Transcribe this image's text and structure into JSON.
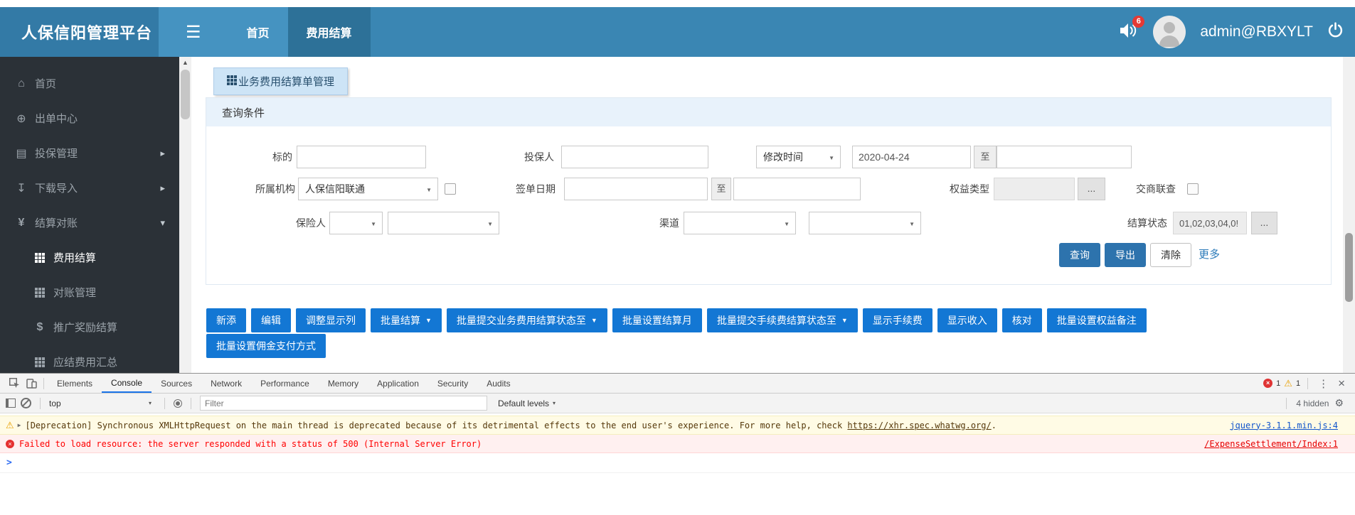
{
  "colors": {
    "navbar": "#3a86b3",
    "navbar_active_tab": "#2d7198",
    "sidebar_bg": "#2b3137",
    "action_button_blue": "#1377d4",
    "primary_button_blue": "#2d73ad",
    "badge_red": "#e53935",
    "devtools_active_tab_underline": "#1a73e8",
    "console_warning_bg": "#fffbe5",
    "console_error_bg": "#fff0f0"
  },
  "icons": {
    "burger": "☰",
    "caret_down": "▼",
    "caret_small": "▾",
    "chevron_right": "▸",
    "chevron_down": "▾",
    "scroll_up": "▲",
    "home": "⌂",
    "globe": "⊕",
    "document": "▤",
    "download": "↧",
    "yen": "¥",
    "dollar": "$",
    "warning": "⚠",
    "gear": "⚙",
    "dots": "⋮",
    "close": "×",
    "cross": "×",
    "expand": "▶"
  },
  "navbar": {
    "title": "人保信阳管理平台",
    "home_tab": "首页",
    "active_tab": "费用结算",
    "notification_count": "6",
    "username": "admin@RBXYLT"
  },
  "sidebar": {
    "items": [
      {
        "label": "首页",
        "icon": "home"
      },
      {
        "label": "出单中心",
        "icon": "globe"
      },
      {
        "label": "投保管理",
        "icon": "document",
        "chevron": "right"
      },
      {
        "label": "下载导入",
        "icon": "download",
        "chevron": "right"
      },
      {
        "label": "结算对账",
        "icon": "yen",
        "chevron": "down"
      },
      {
        "label": "费用结算",
        "icon": "grid",
        "active": true
      },
      {
        "label": "对账管理",
        "icon": "grid"
      },
      {
        "label": "推广奖励结算",
        "icon": "dollar"
      },
      {
        "label": "应结费用汇总",
        "icon": "grid"
      }
    ]
  },
  "main": {
    "page_tab": "业务费用结算单管理",
    "panel_title": "查询条件",
    "form": {
      "subject_label": "标的",
      "applicant_label": "投保人",
      "time_type": "修改时间",
      "date_from": "2020-04-24",
      "to": "至",
      "org_label": "所属机构",
      "org_value": "人保信阳联通",
      "sign_date_label": "签单日期",
      "equity_label": "权益类型",
      "ellipsis": "...",
      "cross_check_label": "交商联查",
      "insurer_label": "保险人",
      "channel_label": "渠道",
      "settle_status_label": "结算状态",
      "settle_status_value": "01,02,03,04,0!"
    },
    "query_btn": "查询",
    "export_btn": "导出",
    "clear_btn": "清除",
    "more_link": "更多",
    "actions_row1": [
      "新添",
      "编辑",
      "调整显示列",
      "批量结算",
      "批量提交业务费用结算状态至",
      "批量设置结算月",
      "批量提交手续费结算状态至",
      "显示手续费",
      "显示收入",
      "核对",
      "批量设置权益备注"
    ],
    "actions_row2": [
      "批量设置佣金支付方式"
    ]
  },
  "devtools": {
    "tabs": [
      "Elements",
      "Console",
      "Sources",
      "Network",
      "Performance",
      "Memory",
      "Application",
      "Security",
      "Audits"
    ],
    "active_tab": "Console",
    "error_count": "1",
    "warning_count": "1",
    "context_selector": "top",
    "filter_placeholder": "Filter",
    "levels_label": "Default levels",
    "hidden_label": "4 hidden",
    "console": {
      "warning_text": "[Deprecation] Synchronous XMLHttpRequest on the main thread is deprecated because of its detrimental effects to the end user's experience. For more help, check ",
      "warning_link": "https://xhr.spec.whatwg.org/",
      "warning_suffix": ".",
      "warning_source": "jquery-3.1.1.min.js:4",
      "error_text": "Failed to load resource: the server responded with a status of 500 (Internal Server Error)",
      "error_source": "/ExpenseSettlement/Index:1",
      "prompt": ">"
    }
  }
}
